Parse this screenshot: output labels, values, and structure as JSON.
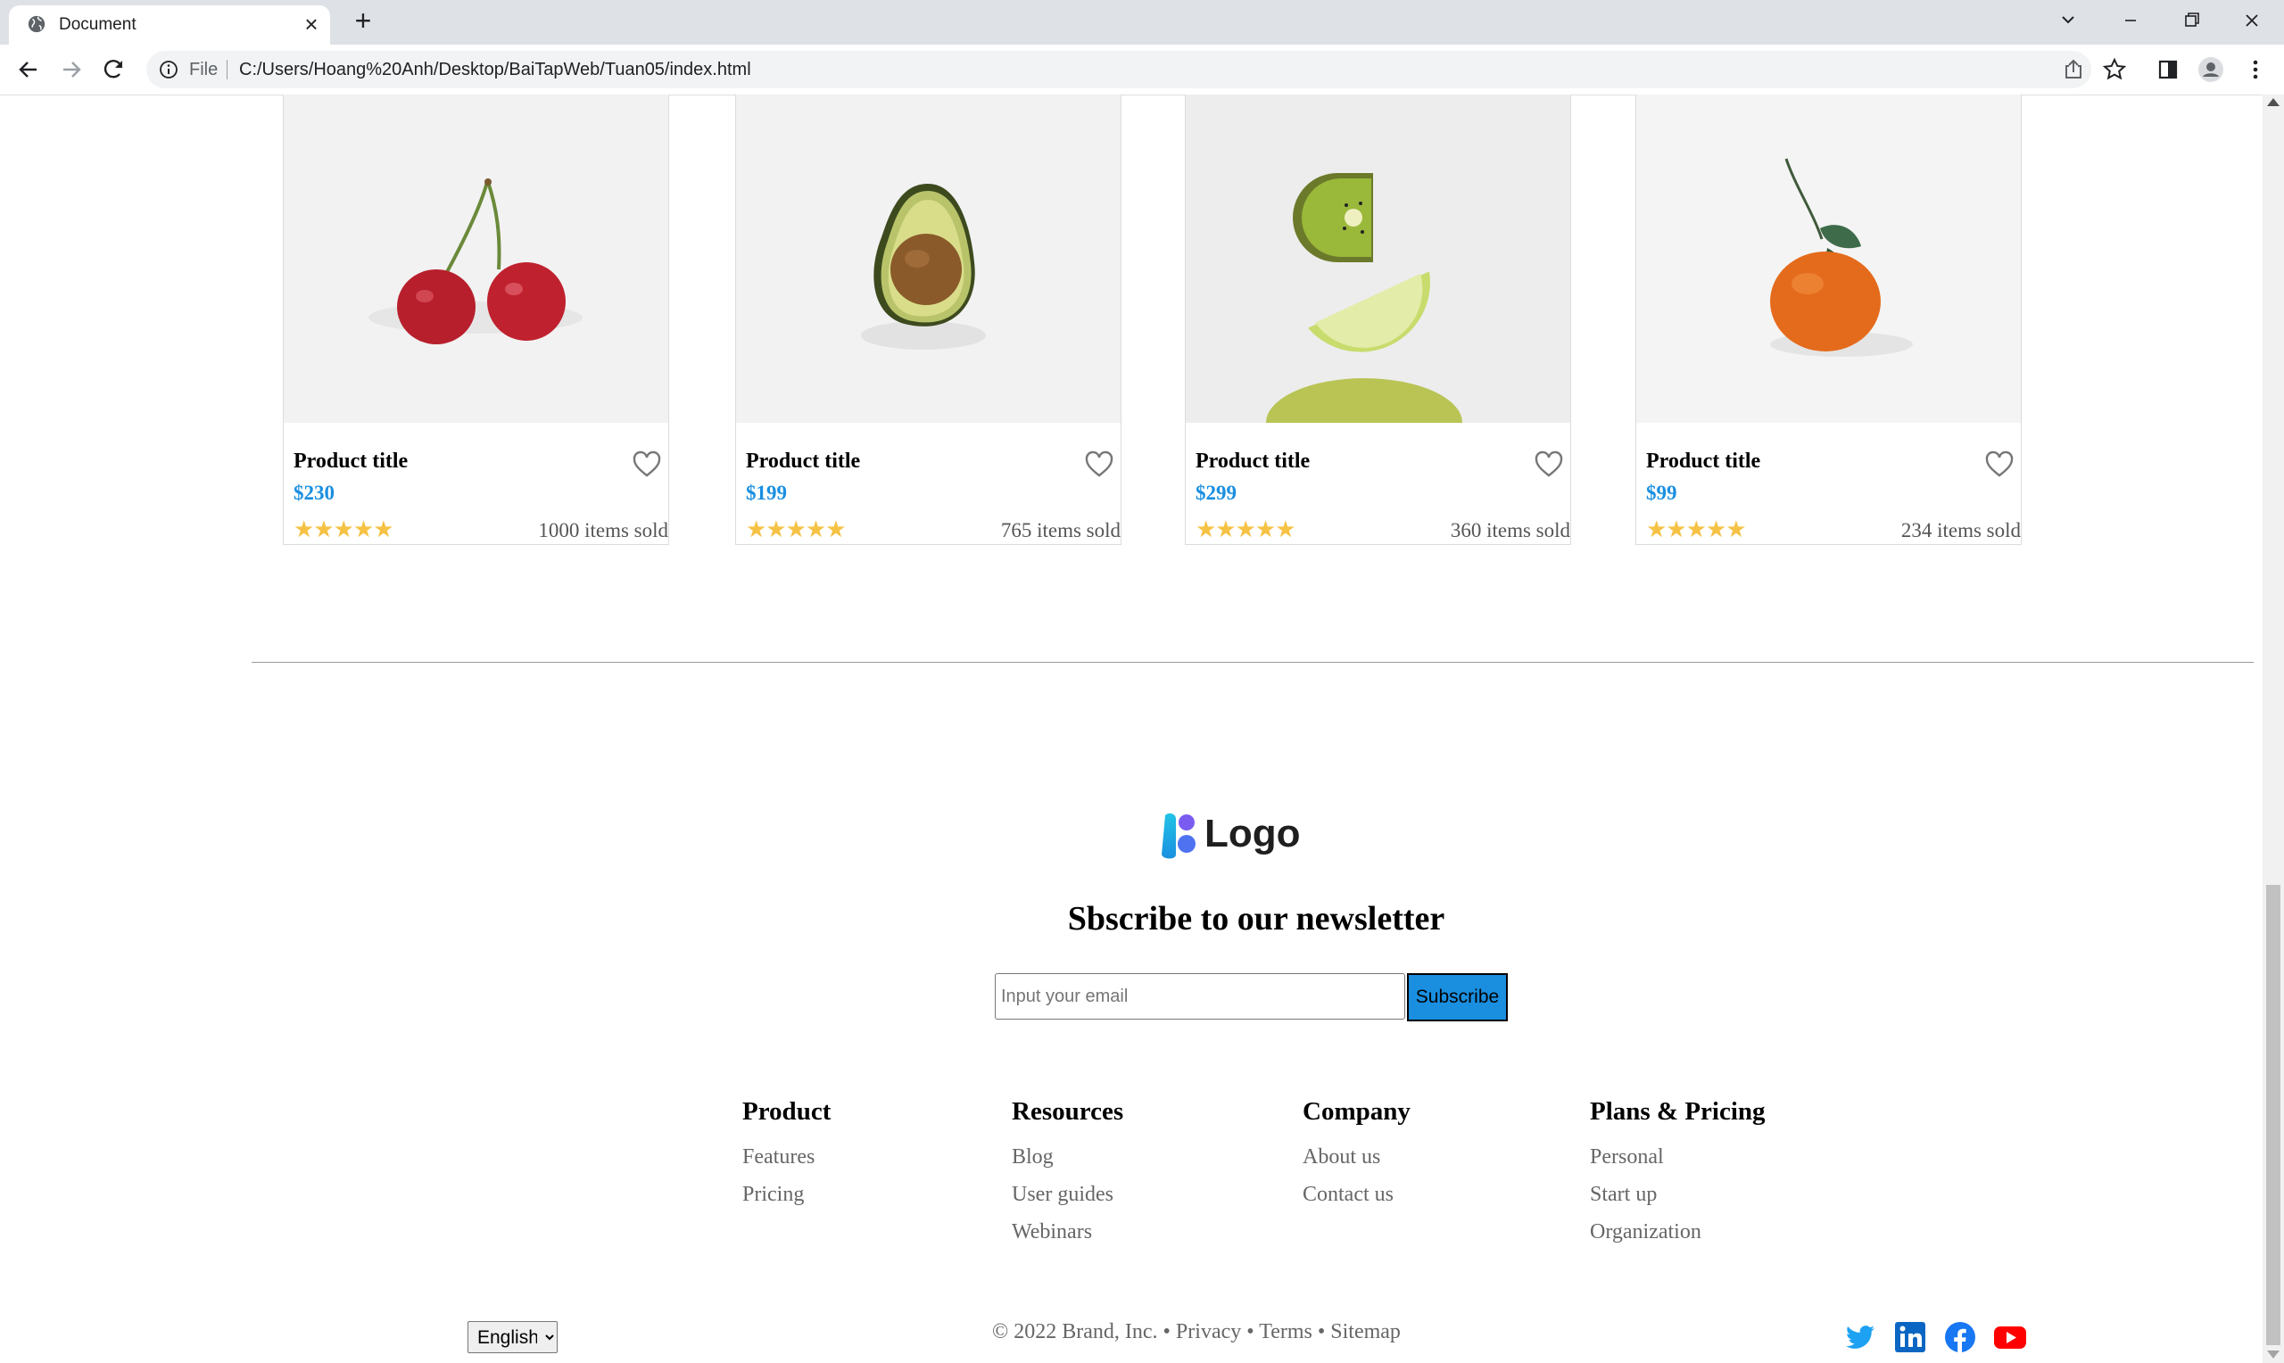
{
  "browser": {
    "tab_title": "Document",
    "omnibox_scheme": "File",
    "url": "C:/Users/Hoang%20Anh/Desktop/BaiTapWeb/Tuan05/index.html",
    "new_tab": "+",
    "close_tab": "×"
  },
  "products": [
    {
      "title": "Product title",
      "price": "$230",
      "stars": "★★★★★",
      "rating": 5,
      "sold": "1000 items sold",
      "image": "cherries"
    },
    {
      "title": "Product title",
      "price": "$199",
      "stars": "★★★★★",
      "rating": 5,
      "sold": "765 items sold",
      "image": "avocado"
    },
    {
      "title": "Product title",
      "price": "$299",
      "stars": "★★★★★",
      "rating": 5,
      "sold": "360 items sold",
      "image": "kiwi-lime"
    },
    {
      "title": "Product title",
      "price": "$99",
      "stars": "★★★★★",
      "rating": 5,
      "sold": "234 items sold",
      "image": "tangerine"
    }
  ],
  "footer": {
    "logo_text": "Logo",
    "newsletter_title": "Sbscribe to our newsletter",
    "email_placeholder": "Input your email",
    "subscribe_label": "Subscribe",
    "columns": [
      {
        "heading": "Product",
        "links": [
          "Features",
          "Pricing"
        ]
      },
      {
        "heading": "Resources",
        "links": [
          "Blog",
          "User guides",
          "Webinars"
        ]
      },
      {
        "heading": "Company",
        "links": [
          "About us",
          "Contact us"
        ]
      },
      {
        "heading": "Plans & Pricing",
        "links": [
          "Personal",
          "Start up",
          "Organization"
        ]
      }
    ],
    "language": "English",
    "legal": "© 2022 Brand, Inc. • Privacy • Terms • Sitemap",
    "social": [
      "twitter-icon",
      "linkedin-icon",
      "facebook-icon",
      "youtube-icon"
    ]
  },
  "colors": {
    "accent": "#1a8fe0",
    "star": "#f6c244",
    "muted_text": "#666666"
  }
}
